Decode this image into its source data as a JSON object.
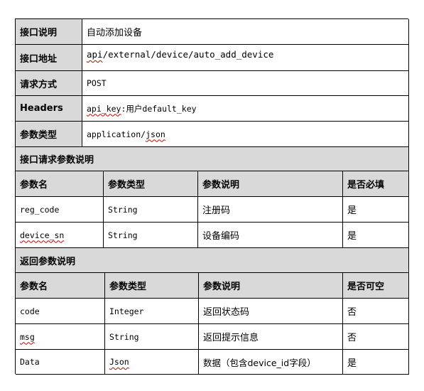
{
  "header_rows": [
    {
      "key": "接口说明",
      "value": "自动添加设备"
    },
    {
      "key": "接口地址",
      "value_prefix": "api",
      "value_rest": "/external/device/auto_add_device"
    },
    {
      "key": "请求方式",
      "value": "POST"
    },
    {
      "key": "Headers",
      "value_prefix": "api_key",
      "value_rest": ":用户default_key"
    },
    {
      "key": "参数类型",
      "value_prefix": "application/",
      "value_rest": "json"
    }
  ],
  "request_section": {
    "title": "接口请求参数说明",
    "columns": [
      "参数名",
      "参数类型",
      "参数说明",
      "是否必填"
    ],
    "rows": [
      [
        "reg_code",
        "String",
        "注册码",
        "是"
      ],
      [
        "device_sn",
        "String",
        "设备编码",
        "是"
      ]
    ]
  },
  "response_section": {
    "title": "返回参数说明",
    "columns": [
      "参数名",
      "参数类型",
      "参数说明",
      "是否可空"
    ],
    "rows": [
      [
        "code",
        "Integer",
        "返回状态码",
        "否"
      ],
      [
        "msg",
        "String",
        "返回提示信息",
        "否"
      ],
      [
        "Data",
        "Json",
        "数据（包含device_id字段）",
        "是"
      ]
    ]
  }
}
